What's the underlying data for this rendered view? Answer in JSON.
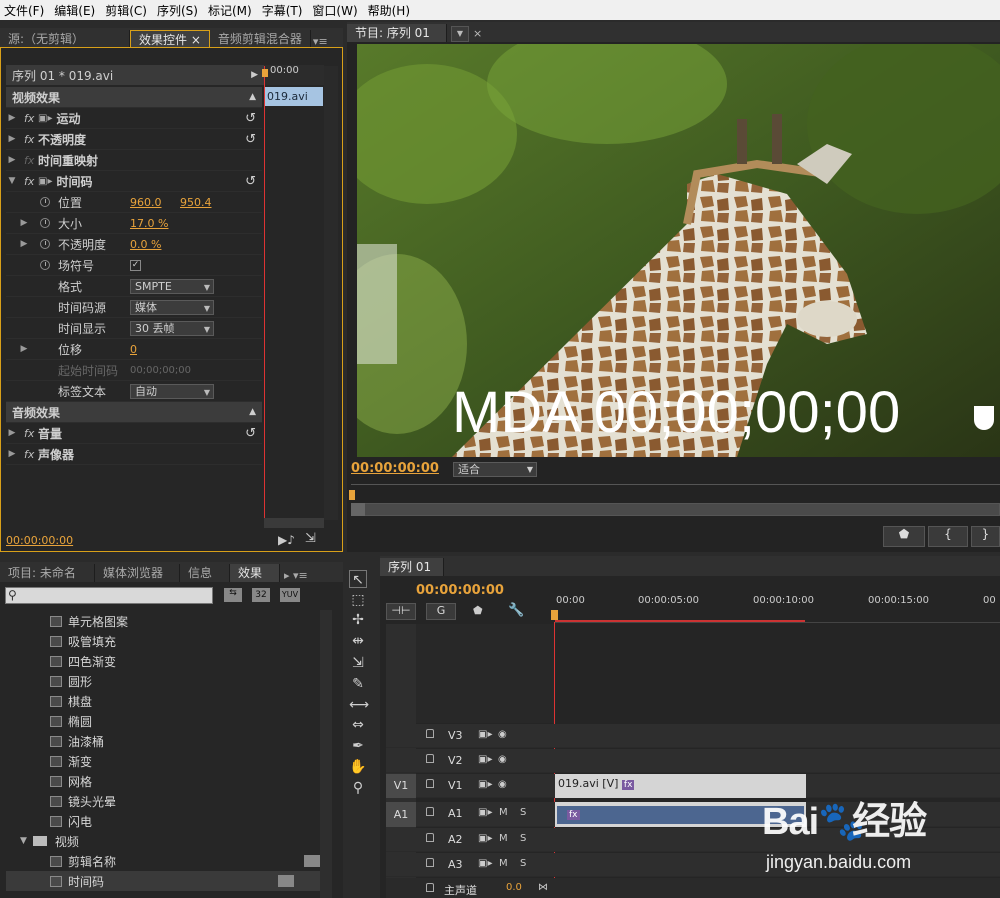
{
  "menu": [
    "文件(F)",
    "编辑(E)",
    "剪辑(C)",
    "序列(S)",
    "标记(M)",
    "字幕(T)",
    "窗口(W)",
    "帮助(H)"
  ],
  "left_tabs": {
    "source": "源:（无剪辑）",
    "effect_controls": "效果控件",
    "audio_mixer": "音频剪辑混合器"
  },
  "effect_controls": {
    "sequence": "序列 01 * 019.avi",
    "mini_time": "00:00",
    "clip_name": "019.avi",
    "video_header": "视频效果",
    "motion": "运动",
    "opacity": "不透明度",
    "time_remap": "时间重映射",
    "timecode": "时间码",
    "position_label": "位置",
    "position_x": "960.0",
    "position_y": "950.4",
    "size_label": "大小",
    "size_value": "17.0 %",
    "opacity_label": "不透明度",
    "opacity_value": "0.0 %",
    "field_label": "场符号",
    "format_label": "格式",
    "format_value": "SMPTE",
    "source_label": "时间码源",
    "source_value": "媒体",
    "display_label": "时间显示",
    "display_value": "30 丢帧",
    "offset_label": "位移",
    "offset_value": "0",
    "start_label": "起始时间码",
    "start_value": "00;00;00;00",
    "label_text_label": "标签文本",
    "label_text_value": "自动",
    "audio_header": "音频效果",
    "volume": "音量",
    "panner": "声像器",
    "time": "00:00:00:00"
  },
  "program": {
    "tab": "节目: 序列 01",
    "overlay": "MDA 00;00;00;00",
    "time": "00:00:00:00",
    "fit": "适合",
    "btn_left": "{",
    "btn_right": "}"
  },
  "project_tabs": {
    "project": "项目: 未命名",
    "media": "媒体浏览器",
    "info": "信息",
    "effects": "效果"
  },
  "effects_list": {
    "items": [
      "单元格图案",
      "吸管填充",
      "四色渐变",
      "圆形",
      "棋盘",
      "椭圆",
      "油漆桶",
      "渐变",
      "网格",
      "镜头光晕",
      "闪电"
    ],
    "folder": "视频",
    "sub_items": [
      "剪辑名称",
      "时间码"
    ],
    "badges": [
      "32",
      "YUV"
    ]
  },
  "timeline": {
    "tab": "序列 01",
    "time": "00:00:00:00",
    "ruler": [
      "00:00",
      "00:00:05:00",
      "00:00:10:00",
      "00:00:15:00",
      "00"
    ],
    "tracks": {
      "v3": "V3",
      "v2": "V2",
      "v1": "V1",
      "a1": "A1",
      "a2": "A2",
      "a3": "A3",
      "master": "主声道",
      "master_value": "0.0",
      "src_v": "V1",
      "src_a": "A1"
    },
    "ms": {
      "m": "M",
      "s": "S"
    },
    "clip_video": "019.avi [V]",
    "fx": "fx"
  },
  "watermark": {
    "brand": "Bai",
    "brand2": "经验",
    "url": "jingyan.baidu.com"
  }
}
